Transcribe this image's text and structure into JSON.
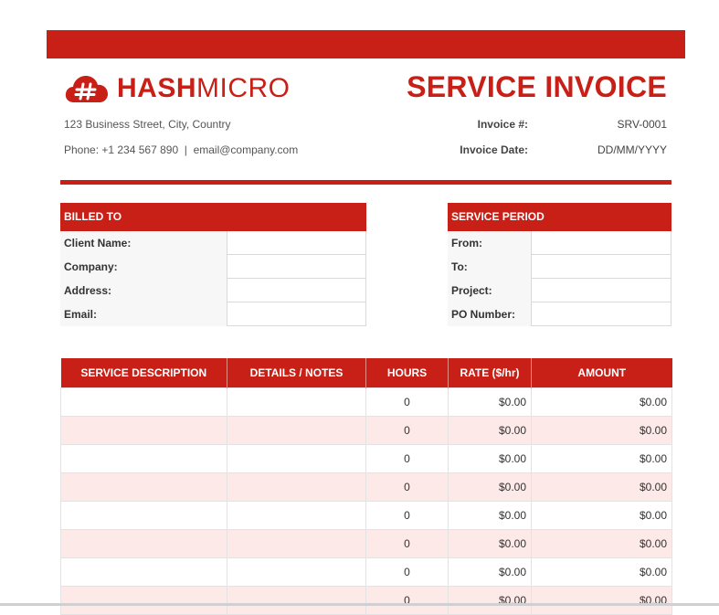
{
  "brand": {
    "name_bold": "HASH",
    "name_light": "MICRO",
    "accent": "#c81f17"
  },
  "header": {
    "title": "SERVICE INVOICE",
    "address": "123 Business Street, City, Country",
    "contact": "Phone: +1 234 567 890  |  email@company.com",
    "invoice_no_label": "Invoice #:",
    "invoice_no_value": "SRV-0001",
    "invoice_date_label": "Invoice Date:",
    "invoice_date_value": "DD/MM/YYYY"
  },
  "billed_to": {
    "heading": "BILLED TO",
    "fields": [
      {
        "label": "Client Name:",
        "value": ""
      },
      {
        "label": "Company:",
        "value": ""
      },
      {
        "label": "Address:",
        "value": ""
      },
      {
        "label": "Email:",
        "value": ""
      }
    ]
  },
  "service_period": {
    "heading": "SERVICE PERIOD",
    "fields": [
      {
        "label": "From:",
        "value": ""
      },
      {
        "label": "To:",
        "value": ""
      },
      {
        "label": "Project:",
        "value": ""
      },
      {
        "label": "PO Number:",
        "value": ""
      }
    ]
  },
  "items": {
    "columns": [
      "SERVICE DESCRIPTION",
      "DETAILS / NOTES",
      "HOURS",
      "RATE ($/hr)",
      "AMOUNT"
    ],
    "rows": [
      {
        "description": "",
        "details": "",
        "hours": "0",
        "rate": "$0.00",
        "amount": "$0.00"
      },
      {
        "description": "",
        "details": "",
        "hours": "0",
        "rate": "$0.00",
        "amount": "$0.00"
      },
      {
        "description": "",
        "details": "",
        "hours": "0",
        "rate": "$0.00",
        "amount": "$0.00"
      },
      {
        "description": "",
        "details": "",
        "hours": "0",
        "rate": "$0.00",
        "amount": "$0.00"
      },
      {
        "description": "",
        "details": "",
        "hours": "0",
        "rate": "$0.00",
        "amount": "$0.00"
      },
      {
        "description": "",
        "details": "",
        "hours": "0",
        "rate": "$0.00",
        "amount": "$0.00"
      },
      {
        "description": "",
        "details": "",
        "hours": "0",
        "rate": "$0.00",
        "amount": "$0.00"
      },
      {
        "description": "",
        "details": "",
        "hours": "0",
        "rate": "$0.00",
        "amount": "$0.00"
      }
    ]
  }
}
